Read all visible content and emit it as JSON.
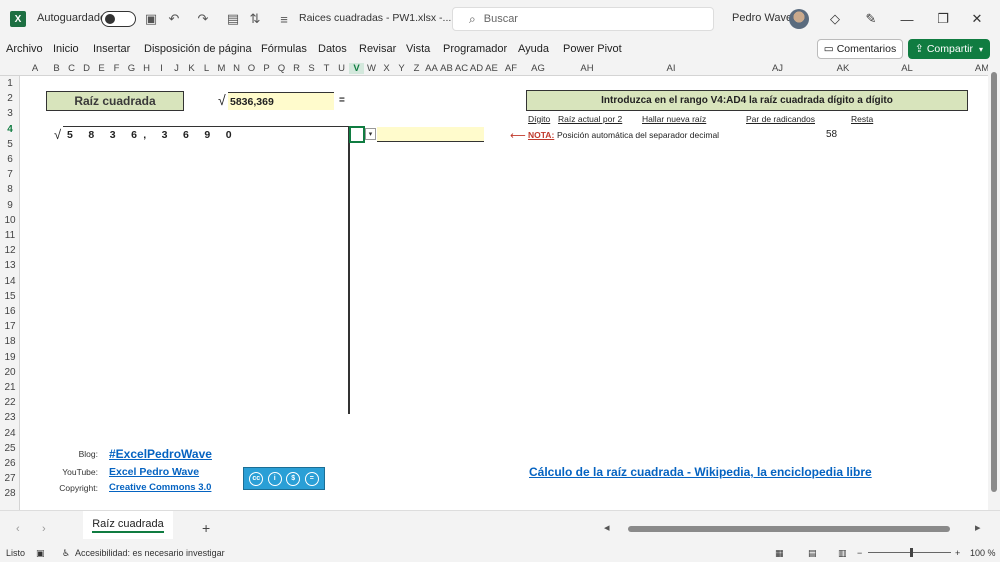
{
  "titlebar": {
    "app_icon": "X",
    "autosave_label": "Autoguardado",
    "filename": "Raices cuadradas - PW1.xlsx  -...",
    "search_placeholder": "Buscar",
    "user": "Pedro Wave"
  },
  "menu": [
    "Archivo",
    "Inicio",
    "Insertar",
    "Disposición de página",
    "Fórmulas",
    "Datos",
    "Revisar",
    "Vista",
    "Programador",
    "Ayuda",
    "Power Pivot"
  ],
  "buttons": {
    "comments": "Comentarios",
    "share": "Compartir"
  },
  "columns": [
    "A",
    "B",
    "C",
    "D",
    "E",
    "F",
    "G",
    "H",
    "I",
    "J",
    "K",
    "L",
    "M",
    "N",
    "O",
    "P",
    "Q",
    "R",
    "S",
    "T",
    "U",
    "V",
    "W",
    "X",
    "Y",
    "Z",
    "AA",
    "AB",
    "AC",
    "AD",
    "AE",
    "AF",
    "AG",
    "AH",
    "AI",
    "AJ",
    "AK",
    "AL",
    "AM"
  ],
  "selected_column": "V",
  "rows": [
    "1",
    "2",
    "3",
    "4",
    "5",
    "6",
    "7",
    "8",
    "9",
    "10",
    "11",
    "12",
    "13",
    "14",
    "15",
    "16",
    "17",
    "18",
    "19",
    "20",
    "21",
    "22",
    "23",
    "24",
    "25",
    "26",
    "27",
    "28"
  ],
  "selected_row": "4",
  "sheet": {
    "title": "Raíz cuadrada",
    "sqrt_symbol": "√",
    "radicand": "5836,369",
    "equals": "=",
    "instruction": "Introduzca en el rango V4:AD4 la raíz cuadrada dígito a dígito",
    "col_labels": [
      "Dígito",
      "Raíz actual por 2",
      "Hallar nueva raíz",
      "Par de radicandos",
      "Resta"
    ],
    "digits": "5 8 3 6, 3 6 9 0",
    "dropdown_glyph": "▾",
    "nota_arrow": "⟵",
    "nota_label": "NOTA:",
    "nota_text": "Posición automática del separador decimal",
    "resta_value": "58",
    "blog_label": "Blog:",
    "blog_link": "#ExcelPedroWave",
    "youtube_label": "YouTube:",
    "youtube_link": "Excel Pedro Wave",
    "copyright_label": "Copyright:",
    "copyright_link": "Creative Commons 3.0",
    "wiki_link": "Cálculo de la raíz cuadrada - Wikipedia, la enciclopedia libre",
    "cc_badge": [
      "cc",
      "i",
      "$",
      "="
    ]
  },
  "tabs": {
    "active": "Raíz cuadrada",
    "add": "+"
  },
  "status": {
    "ready": "Listo",
    "accessibility": "Accesibilidad: es necesario investigar",
    "zoom": "100 %"
  },
  "colors": {
    "accent": "#107c41",
    "header_green": "#d8e4bc",
    "input_yellow": "#fffbcc",
    "link": "#0563c1"
  }
}
